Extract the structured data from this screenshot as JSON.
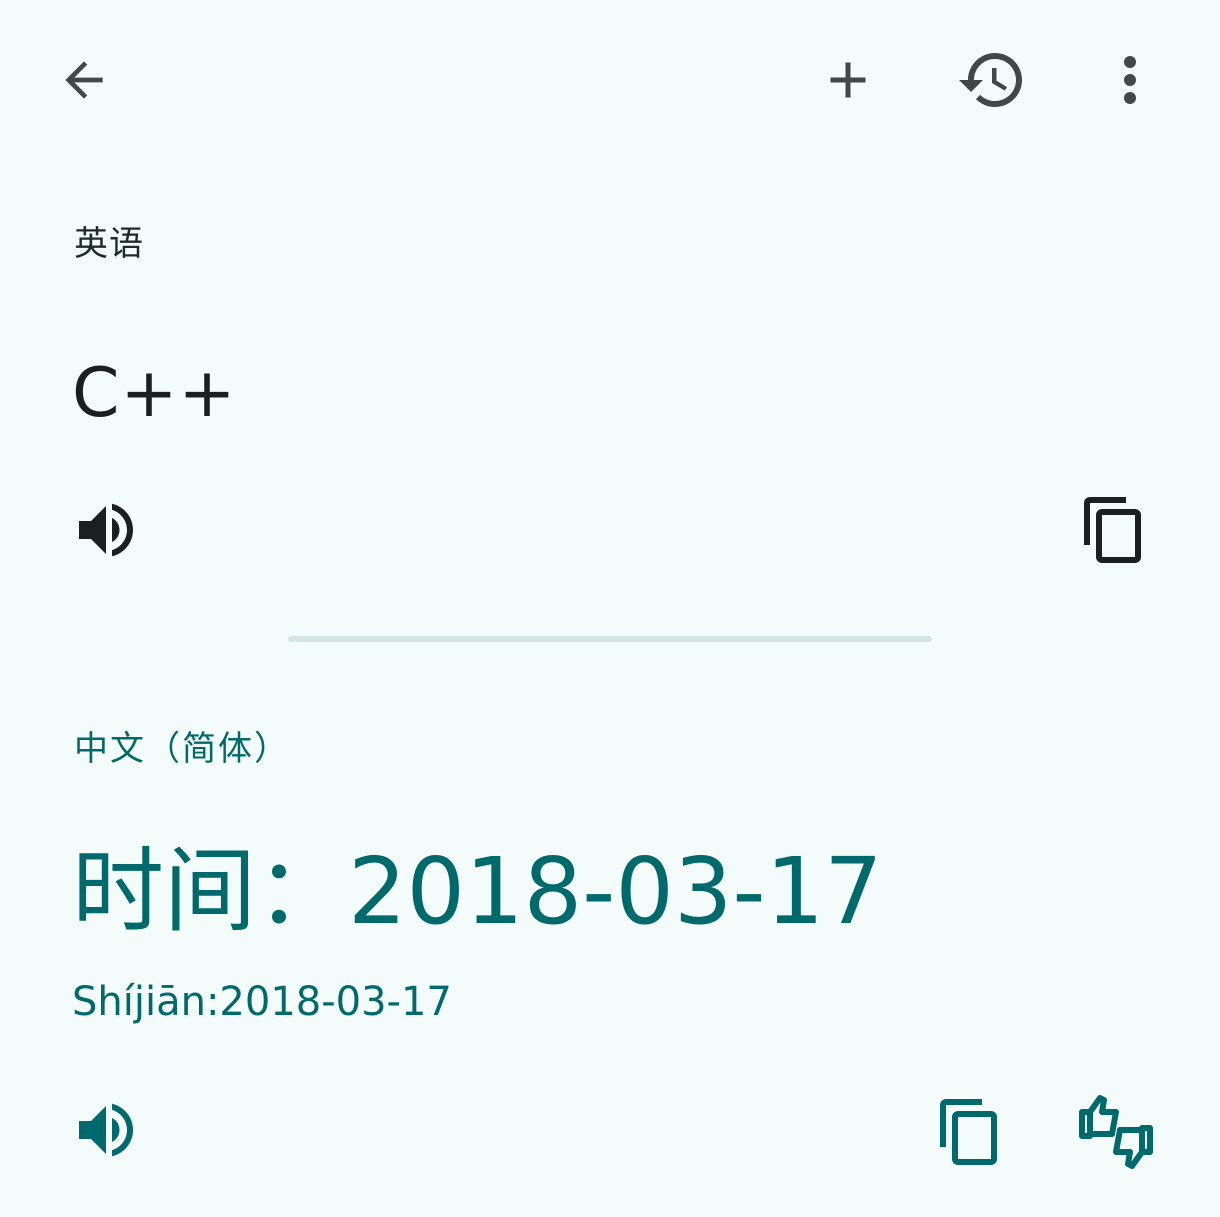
{
  "toolbar": {
    "icons": [
      "arrow-back-icon",
      "add-icon",
      "history-icon",
      "more-vert-icon"
    ]
  },
  "source": {
    "language": "英语",
    "text": "C++",
    "icons": [
      "volume-up-icon",
      "copy-icon"
    ]
  },
  "target": {
    "language": "中文（简体）",
    "text": "时间：2018-03-17",
    "transliteration": "Shíjiān:2018-03-17",
    "icons": [
      "volume-up-icon",
      "copy-icon",
      "thumbs-up-down-icon"
    ]
  },
  "colors": {
    "background": "#f4fbfb",
    "accent": "#00696b",
    "icon_dark": "#1b1f1f",
    "divider": "#d3e6e6"
  }
}
